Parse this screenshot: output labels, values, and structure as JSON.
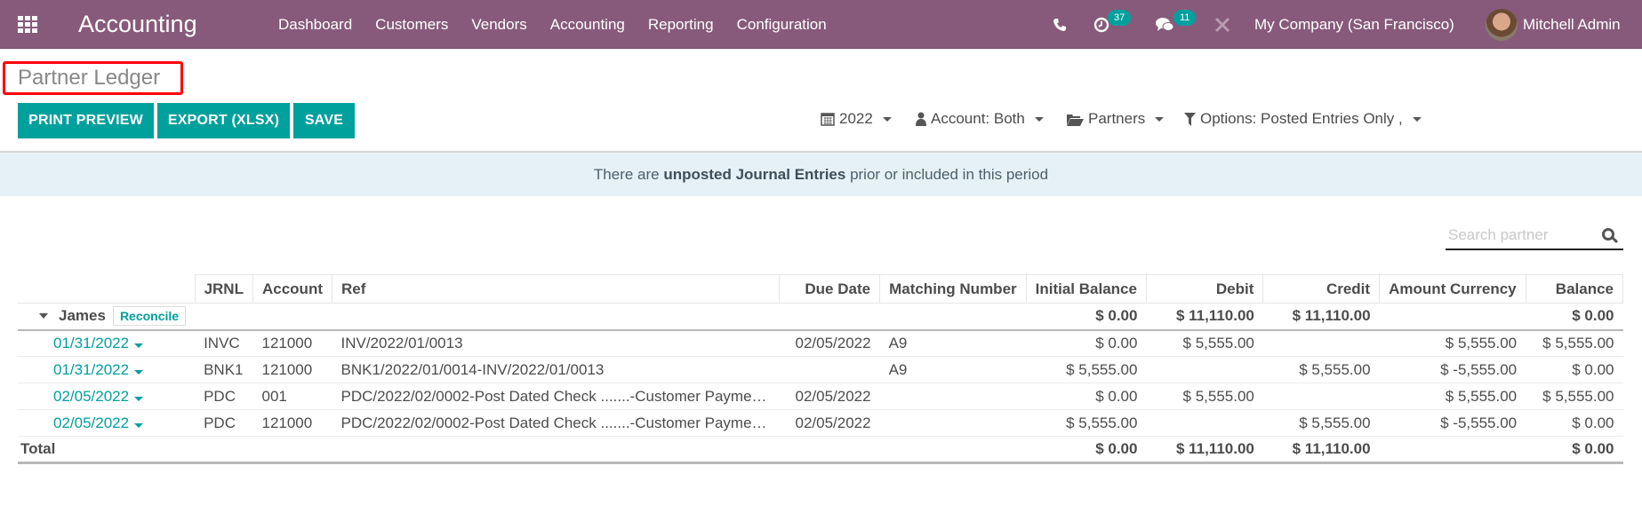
{
  "navbar": {
    "app_name": "Accounting",
    "menu": [
      "Dashboard",
      "Customers",
      "Vendors",
      "Accounting",
      "Reporting",
      "Configuration"
    ],
    "activity_count": "37",
    "messages_count": "11",
    "company": "My Company (San Francisco)",
    "user": "Mitchell Admin",
    "icons": [
      "apps-grid-icon",
      "phone-icon",
      "activity-clock-icon",
      "chat-icon",
      "debug-tools-icon"
    ]
  },
  "control_panel": {
    "breadcrumb": "Partner Ledger",
    "buttons": {
      "print_preview": "PRINT PREVIEW",
      "export": "EXPORT (XLSX)",
      "save": "SAVE"
    },
    "filters": {
      "date": "2022",
      "account": "Account: Both",
      "partners": "Partners",
      "options": "Options: Posted Entries Only ,"
    }
  },
  "alert": {
    "prefix": "There are ",
    "bold": "unposted Journal Entries",
    "suffix": " prior or included in this period"
  },
  "search": {
    "placeholder": "Search partner"
  },
  "table": {
    "headers": [
      "JRNL",
      "Account",
      "Ref",
      "Due Date",
      "Matching Number",
      "Initial Balance",
      "Debit",
      "Credit",
      "Amount Currency",
      "Balance"
    ],
    "partner": {
      "name": "James",
      "reconcile_label": "Reconcile",
      "initial_balance": "$ 0.00",
      "debit": "$ 11,110.00",
      "credit": "$ 11,110.00",
      "amount_currency": "",
      "balance": "$ 0.00"
    },
    "rows": [
      {
        "date": "01/31/2022",
        "jrnl": "INVC",
        "account": "121000",
        "ref": "INV/2022/01/0013",
        "due_date": "02/05/2022",
        "matching": "A9",
        "initial_balance": "$ 0.00",
        "debit": "$ 5,555.00",
        "credit": "",
        "amount_currency": "$ 5,555.00",
        "balance": "$ 5,555.00"
      },
      {
        "date": "01/31/2022",
        "jrnl": "BNK1",
        "account": "121000",
        "ref": "BNK1/2022/01/0014-INV/2022/01/0013",
        "due_date": "",
        "matching": "A9",
        "initial_balance": "$ 5,555.00",
        "debit": "",
        "credit": "$ 5,555.00",
        "amount_currency": "$ -5,555.00",
        "balance": "$ 0.00"
      },
      {
        "date": "02/05/2022",
        "jrnl": "PDC",
        "account": "001",
        "ref": "PDC/2022/02/0002-Post Dated Check .......-Customer Payme…",
        "due_date": "02/05/2022",
        "matching": "",
        "initial_balance": "$ 0.00",
        "debit": "$ 5,555.00",
        "credit": "",
        "amount_currency": "$ 5,555.00",
        "balance": "$ 5,555.00"
      },
      {
        "date": "02/05/2022",
        "jrnl": "PDC",
        "account": "121000",
        "ref": "PDC/2022/02/0002-Post Dated Check .......-Customer Payme…",
        "due_date": "02/05/2022",
        "matching": "",
        "initial_balance": "$ 5,555.00",
        "debit": "",
        "credit": "$ 5,555.00",
        "amount_currency": "$ -5,555.00",
        "balance": "$ 0.00"
      }
    ],
    "total": {
      "label": "Total",
      "initial_balance": "$ 0.00",
      "debit": "$ 11,110.00",
      "credit": "$ 11,110.00",
      "amount_currency": "",
      "balance": "$ 0.00"
    }
  },
  "colors": {
    "navbar": "#875a7b",
    "primary": "#00a09d",
    "highlight_box": "#ff0000",
    "alert_bg": "#e6f1f7"
  }
}
